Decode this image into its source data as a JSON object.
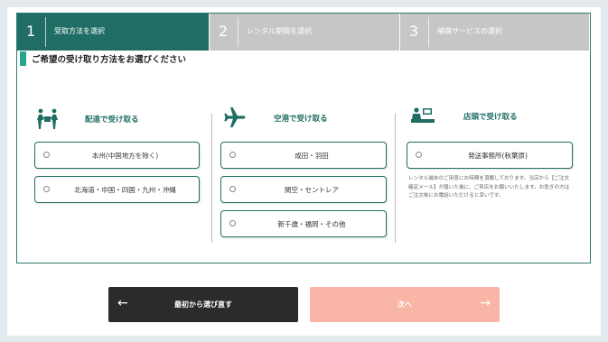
{
  "steps": [
    {
      "num": "1",
      "label": "受取方法を選択"
    },
    {
      "num": "2",
      "label": "レンタル期間を選択"
    },
    {
      "num": "3",
      "label": "補償サービスの選択"
    }
  ],
  "title": "ご希望の受け取り方法をお選びください",
  "columns": {
    "delivery": {
      "heading": "配達で受け取る",
      "options": [
        "本州(中国地方を除く)",
        "北海道・中国・四国・九州・沖縄"
      ]
    },
    "airport": {
      "heading": "空港で受け取る",
      "options": [
        "成田・羽田",
        "関空・セントレア",
        "新千歳・福岡・その他"
      ]
    },
    "store": {
      "heading": "店頭で受け取る",
      "options": [
        "発送事務所(秋葉原)"
      ],
      "note": "レンタル端末のご用意にお時間を頂戴しております。当店から【ご注文確定メール】が届いた後に、ご来店をお願いいたします。お急ぎの方はご注文後にお電話いただけると幸いです。"
    }
  },
  "buttons": {
    "back": "最初から選び直す",
    "next": "次へ"
  },
  "colors": {
    "accent": "#1f6d64",
    "title_bar": "#2aa58d",
    "inactive_step": "#c6c6c6",
    "back_button": "#2b2b2b",
    "next_button_disabled": "#f9b5a6"
  },
  "icons": {
    "delivery": "delivery-person-icon",
    "airport": "airplane-icon",
    "store": "store-counter-icon"
  }
}
